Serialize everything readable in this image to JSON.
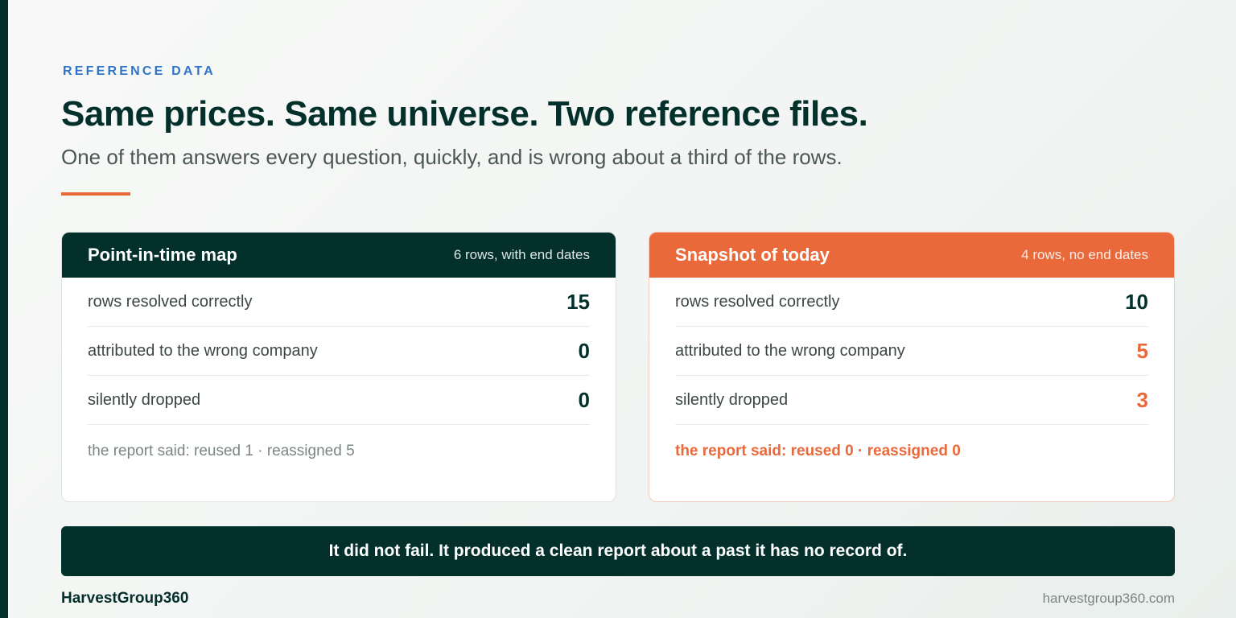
{
  "eyebrow": "REFERENCE DATA",
  "title": "Same prices. Same universe. Two reference files.",
  "subtitle": "One of them answers every question, quickly, and is wrong about a third of the rows.",
  "cards": [
    {
      "title": "Point-in-time map",
      "meta": "6 rows, with end dates",
      "rows": [
        {
          "label": "rows resolved correctly",
          "value": "15"
        },
        {
          "label": "attributed to the wrong company",
          "value": "0"
        },
        {
          "label": "silently dropped",
          "value": "0"
        }
      ],
      "note": "the report said: reused 1 · reassigned 5"
    },
    {
      "title": "Snapshot of today",
      "meta": "4 rows, no end dates",
      "rows": [
        {
          "label": "rows resolved correctly",
          "value": "10"
        },
        {
          "label": "attributed to the wrong company",
          "value": "5"
        },
        {
          "label": "silently dropped",
          "value": "3"
        }
      ],
      "note": "the report said: reused 0 · reassigned 0"
    }
  ],
  "banner": "It did not fail. It produced a clean report about a past it has no record of.",
  "footer": {
    "brand": "HarvestGroup360",
    "url": "harvestgroup360.com"
  },
  "colors": {
    "dark_green": "#03302b",
    "accent_orange": "#e9693a",
    "eyebrow_blue": "#2f74c9"
  }
}
